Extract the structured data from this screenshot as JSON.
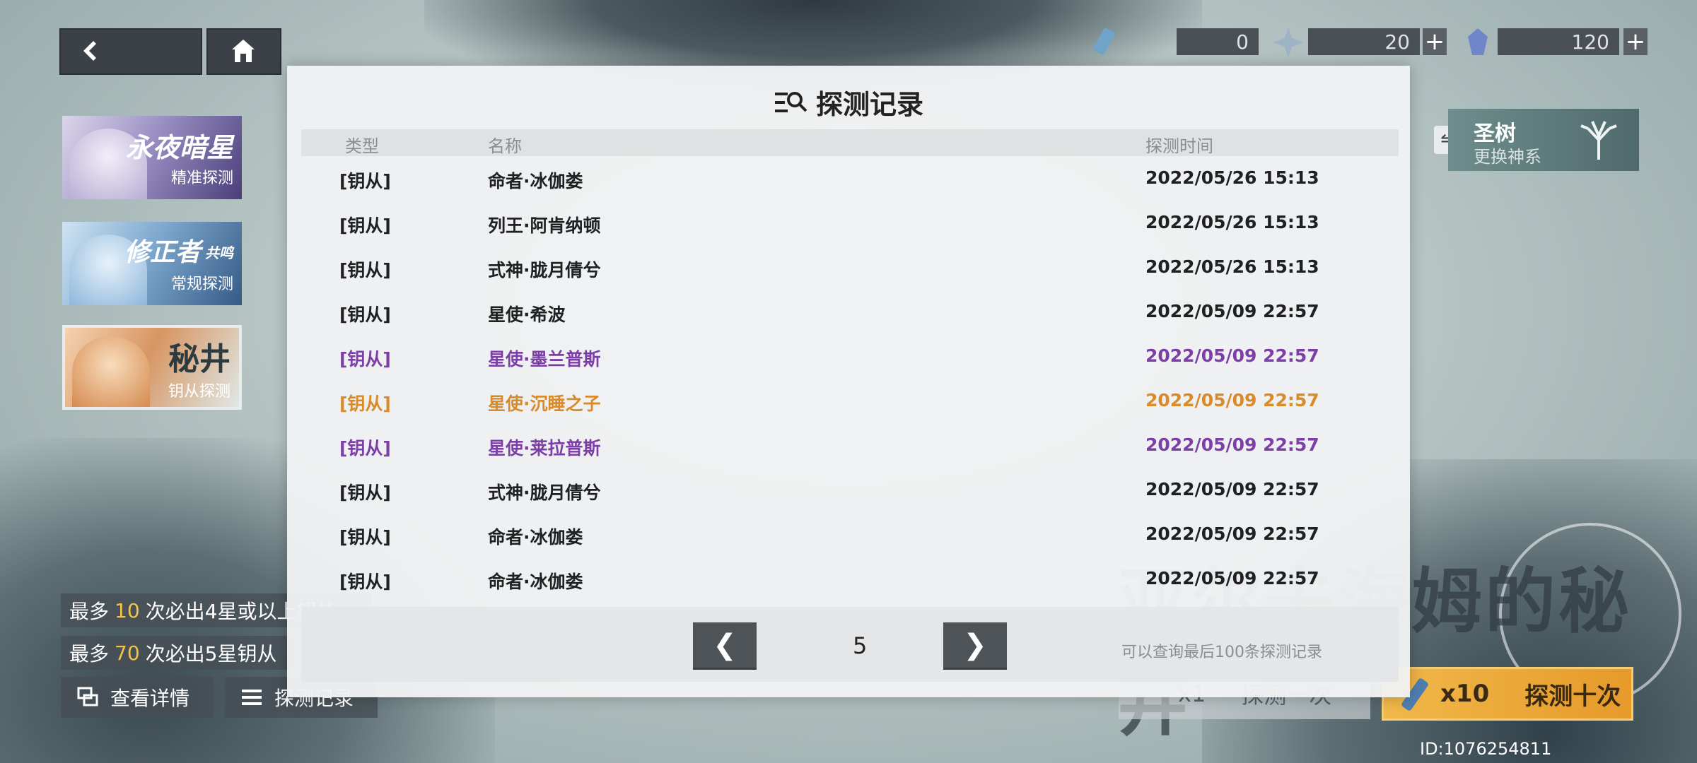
{
  "currency": [
    {
      "name": "ticket",
      "value": "0"
    },
    {
      "name": "star-crystal",
      "value": "20",
      "plus": "+"
    },
    {
      "name": "blue-crystal",
      "value": "120",
      "plus": "+"
    }
  ],
  "banners": [
    {
      "title": "永夜暗星",
      "subtitle": "精准探测"
    },
    {
      "title": "修正者",
      "title_suffix": "共鸣",
      "subtitle": "常规探测"
    },
    {
      "title": "秘井",
      "subtitle": "钥从探测"
    }
  ],
  "sacred_tree": {
    "title": "圣树",
    "subtitle": "更换神系"
  },
  "big_title": "亚尔夫海姆的秘井",
  "info": {
    "line1": {
      "prefix": "最多",
      "count": "10",
      "suffix": "次必出4星或以上钥从"
    },
    "line2": {
      "prefix": "最多",
      "count": "70",
      "suffix": "次必出5星钥从"
    }
  },
  "buttons": {
    "details": "查看详情",
    "records": "探测记录"
  },
  "draw": {
    "single": {
      "count": "x1",
      "label": "探测一次"
    },
    "ten": {
      "count": "x10",
      "label": "探测十次"
    }
  },
  "player_id": "ID:1076254811",
  "modal": {
    "title": "探测记录",
    "headers": {
      "type": "类型",
      "name": "名称",
      "time": "探测时间"
    },
    "rows": [
      {
        "type": "[钥从]",
        "name": "命者·冰伽娄",
        "time": "2022/05/26 15:13",
        "rarity": "normal"
      },
      {
        "type": "[钥从]",
        "name": "列王·阿肯纳顿",
        "time": "2022/05/26 15:13",
        "rarity": "normal"
      },
      {
        "type": "[钥从]",
        "name": "式神·胧月倩兮",
        "time": "2022/05/26 15:13",
        "rarity": "normal"
      },
      {
        "type": "[钥从]",
        "name": "星使·希波",
        "time": "2022/05/09 22:57",
        "rarity": "normal"
      },
      {
        "type": "[钥从]",
        "name": "星使·墨兰普斯",
        "time": "2022/05/09 22:57",
        "rarity": "purple"
      },
      {
        "type": "[钥从]",
        "name": "星使·沉睡之子",
        "time": "2022/05/09 22:57",
        "rarity": "orange"
      },
      {
        "type": "[钥从]",
        "name": "星使·莱拉普斯",
        "time": "2022/05/09 22:57",
        "rarity": "purple"
      },
      {
        "type": "[钥从]",
        "name": "式神·胧月倩兮",
        "time": "2022/05/09 22:57",
        "rarity": "normal"
      },
      {
        "type": "[钥从]",
        "name": "命者·冰伽娄",
        "time": "2022/05/09 22:57",
        "rarity": "normal"
      },
      {
        "type": "[钥从]",
        "name": "命者·冰伽娄",
        "time": "2022/05/09 22:57",
        "rarity": "normal"
      }
    ],
    "pager": {
      "prev": "❮",
      "page": "5",
      "next": "❯",
      "note": "可以查询最后100条探测记录"
    }
  },
  "colors": {
    "purple": "#7b3fa5",
    "orange": "#d98b2a",
    "highlight": "#f3c14c"
  }
}
